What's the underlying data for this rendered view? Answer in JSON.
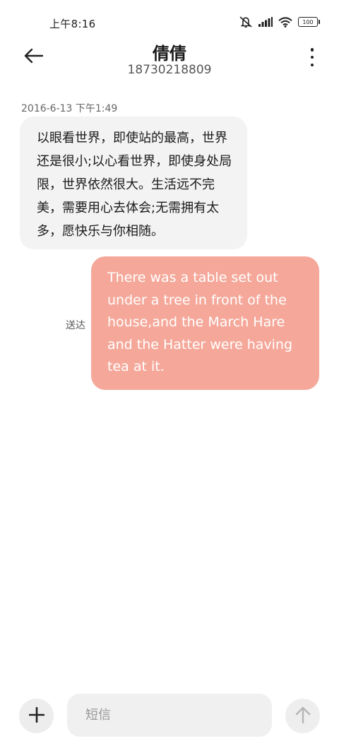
{
  "status_bar": {
    "time": "上午8:16",
    "battery": "100",
    "icons": [
      "mute-notification-icon",
      "signal-icon",
      "wifi-icon",
      "battery-icon"
    ]
  },
  "header": {
    "contact_name": "倩倩",
    "phone_number": "18730218809",
    "icons": [
      "back-arrow-icon",
      "more-vertical-icon"
    ]
  },
  "conversation": {
    "timestamp": "2016-6-13 下午1:49",
    "messages": [
      {
        "direction": "incoming",
        "text": "以眼看世界，即使站的最高，世界还是很小;以心看世界，即使身处局限，世界依然很大。生活远不完美，需要用心去体会;无需拥有太多，愿快乐与你相随。"
      },
      {
        "direction": "outgoing",
        "text": "There was a table set out under a tree in front of the house,and the March Hare and the Hatter were having tea at it.",
        "status": "送达"
      }
    ]
  },
  "composer": {
    "placeholder": "短信",
    "value": "",
    "icons": [
      "plus-icon",
      "send-arrow-icon"
    ]
  },
  "colors": {
    "incoming_bubble": "#f3f3f3",
    "outgoing_bubble": "#f5a89a",
    "background": "#ffffff"
  }
}
